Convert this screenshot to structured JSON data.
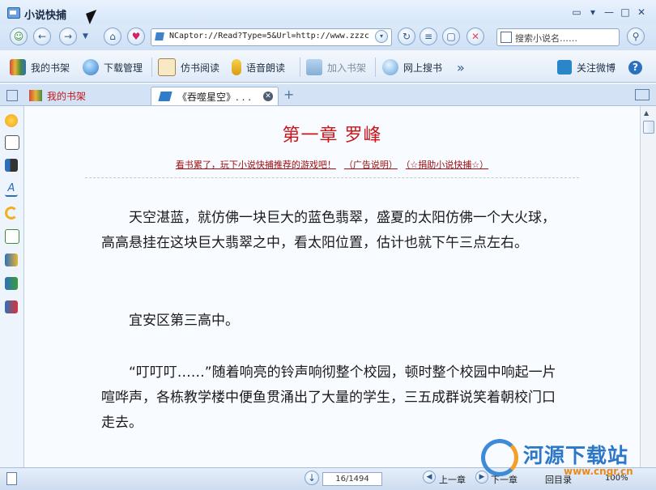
{
  "window": {
    "title": "小说快捕"
  },
  "nav": {
    "address": "NCaptor://Read?Type=5&Url=http://www.zzzc",
    "search_placeholder": "搜索小说名……"
  },
  "toolbar": {
    "items": [
      {
        "label": "我的书架",
        "icon": "bookshelf-icon"
      },
      {
        "label": "下载管理",
        "icon": "globe-download-icon"
      },
      {
        "label": "仿书阅读",
        "icon": "open-book-icon"
      },
      {
        "label": "语音朗读",
        "icon": "microphone-icon"
      },
      {
        "label": "加入书架",
        "icon": "add-book-icon"
      },
      {
        "label": "网上搜书",
        "icon": "web-search-icon"
      }
    ],
    "more": "»",
    "weibo_label": "关注微博",
    "help": "?"
  },
  "tabs": [
    {
      "label": "我的书架"
    },
    {
      "label": "《吞噬星空》. . ."
    }
  ],
  "reader": {
    "chapter_title": "第一章  罗峰",
    "ad_links": [
      "看书累了，玩下小说快捕推荐的游戏吧！",
      "（广告说明）",
      "（☆捐助小说快捕☆）"
    ],
    "paragraphs": [
      "天空湛蓝，就仿佛一块巨大的蓝色翡翠，盛夏的太阳仿佛一个大火球，高高悬挂在这块巨大翡翠之中，看太阳位置，估计也就下午三点左右。",
      "宜安区第三高中。",
      "“叮叮叮……”随着响亮的铃声响彻整个校园，顿时整个校园中响起一片喧哗声，各栋教学楼中便鱼贯涌出了大量的学生，三五成群说笑着朝校门口走去。"
    ]
  },
  "status": {
    "page": "16/1494",
    "prev_chapter": "上一章",
    "next_chapter": "下一章",
    "toc": "回目录",
    "zoom": "100%"
  },
  "watermark": {
    "main": "河源下载站",
    "sub": "www.cngr.cn"
  }
}
